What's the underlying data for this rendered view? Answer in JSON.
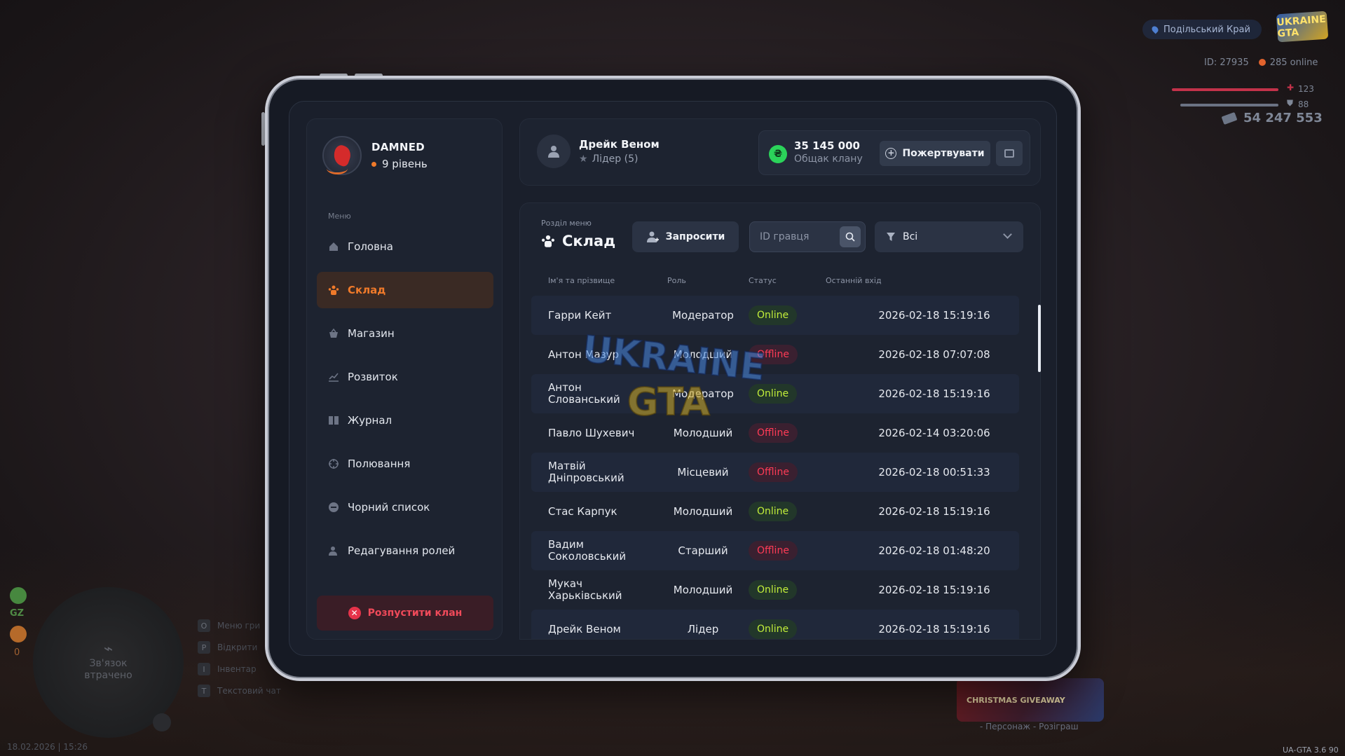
{
  "hud": {
    "server_name": "Подільський Край",
    "logo_text": "UKRAINE GTA",
    "player_id": "ID: 27935",
    "online": "285 online",
    "health": "123",
    "armor": "88",
    "money": "54 247 553",
    "minimap_text_1": "Зв'язок",
    "minimap_text_2": "втрачено",
    "gz_label": "GZ",
    "wanted": "0",
    "keys": [
      {
        "key": "O",
        "label": "Меню гри"
      },
      {
        "key": "P",
        "label": "Відкрити"
      },
      {
        "key": "I",
        "label": "Інвентар"
      },
      {
        "key": "T",
        "label": "Текстовий чат"
      }
    ],
    "datetime": "18.02.2026 | 15:26",
    "promo_text": "CHRISTMAS GIVEAWAY",
    "promo_caption": "- Персонаж - Розіграш",
    "version": "UA-GTA 3.6  90"
  },
  "clan": {
    "name": "DAMNED",
    "level": "9 рівень"
  },
  "menu": {
    "caption": "Меню",
    "items": [
      {
        "label": "Головна",
        "icon": "home-icon"
      },
      {
        "label": "Склад",
        "icon": "members-icon"
      },
      {
        "label": "Магазин",
        "icon": "shop-icon"
      },
      {
        "label": "Розвиток",
        "icon": "chart-icon"
      },
      {
        "label": "Журнал",
        "icon": "book-icon"
      },
      {
        "label": "Полювання",
        "icon": "crosshair-icon"
      },
      {
        "label": "Чорний список",
        "icon": "block-icon"
      },
      {
        "label": "Редагування ролей",
        "icon": "role-edit-icon"
      }
    ],
    "active_index": 1,
    "dissolve_label": "Розпустити клан"
  },
  "header": {
    "user_name": "Дрейк Веном",
    "user_role": "Лідер (5)",
    "treasury_amount": "35 145 000",
    "treasury_label": "Общак клану",
    "donate_label": "Пожертвувати"
  },
  "section": {
    "caption": "Розділ меню",
    "title": "Склад",
    "invite_label": "Запросити",
    "search_placeholder": "ID гравця",
    "filter_value": "Всі"
  },
  "table": {
    "columns": [
      "Ім'я та прізвище",
      "Роль",
      "Статус",
      "Останній вхід"
    ],
    "rows": [
      {
        "name": "Гарри Кейт",
        "role": "Модератор",
        "status": "Online",
        "last": "2026-02-18 15:19:16"
      },
      {
        "name": "Антон Мазур",
        "role": "Молодший",
        "status": "Offline",
        "last": "2026-02-18 07:07:08"
      },
      {
        "name": "Антон Слованський",
        "role": "Модератор",
        "status": "Online",
        "last": "2026-02-18 15:19:16"
      },
      {
        "name": "Павло Шухевич",
        "role": "Молодший",
        "status": "Offline",
        "last": "2026-02-14 03:20:06"
      },
      {
        "name": "Матвій Дніпровський",
        "role": "Місцевий",
        "status": "Offline",
        "last": "2026-02-18 00:51:33"
      },
      {
        "name": "Стас Карпук",
        "role": "Молодший",
        "status": "Online",
        "last": "2026-02-18 15:19:16"
      },
      {
        "name": "Вадим Соколовський",
        "role": "Старший",
        "status": "Offline",
        "last": "2026-02-18 01:48:20"
      },
      {
        "name": "Мукач Харьківський",
        "role": "Молодший",
        "status": "Online",
        "last": "2026-02-18 15:19:16"
      },
      {
        "name": "Дрейк Веном",
        "role": "Лідер",
        "status": "Online",
        "last": "2026-02-18 15:19:16"
      }
    ]
  },
  "colors": {
    "accent": "#f07a2a",
    "online": "#c2ee3a",
    "offline": "#ff3b56",
    "danger": "#e6334a"
  }
}
